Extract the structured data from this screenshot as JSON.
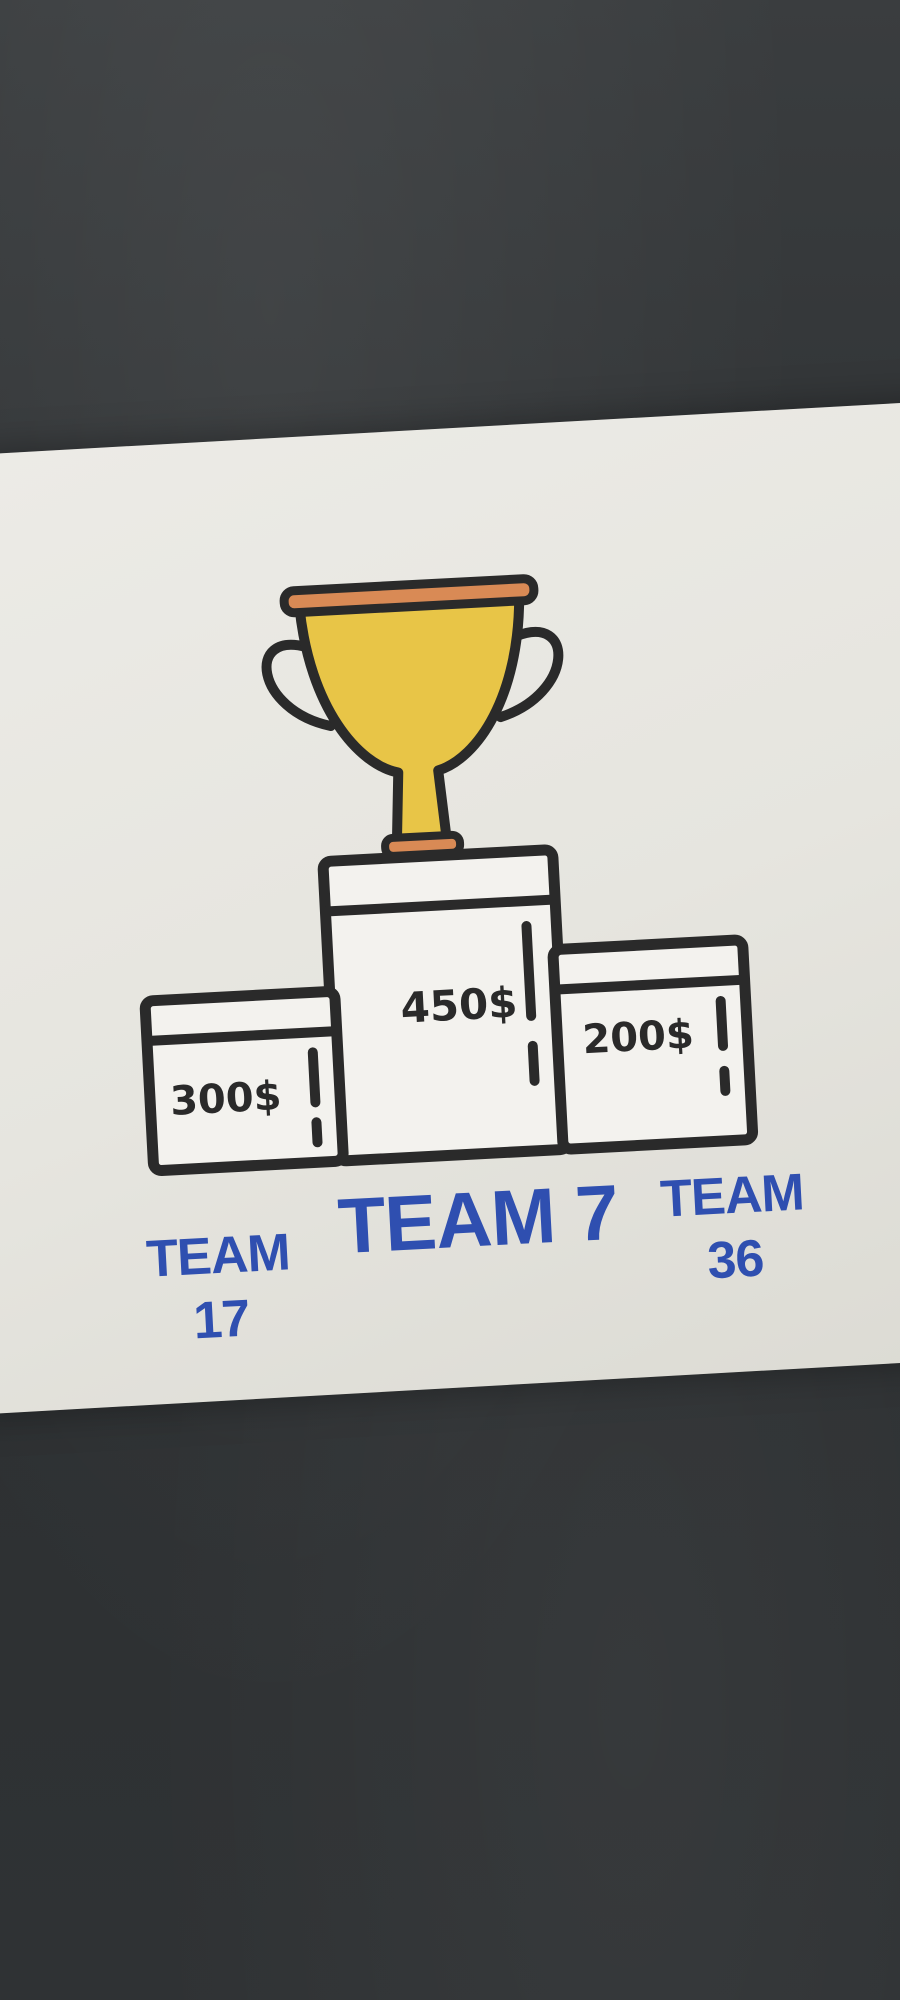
{
  "podium": {
    "first": {
      "prize": "450$",
      "team": "TEAM 7"
    },
    "second": {
      "prize": "300$",
      "team_line1": "TEAM",
      "team_line2": "17"
    },
    "third": {
      "prize": "200$",
      "team_line1": "TEAM",
      "team_line2": "36"
    }
  },
  "colors": {
    "trophy_gold": "#e8c547",
    "trophy_rim": "#d98a55",
    "team_label_blue": "#2f4fb0",
    "outline": "#2a2a2a"
  },
  "icons": [
    "trophy-icon"
  ]
}
